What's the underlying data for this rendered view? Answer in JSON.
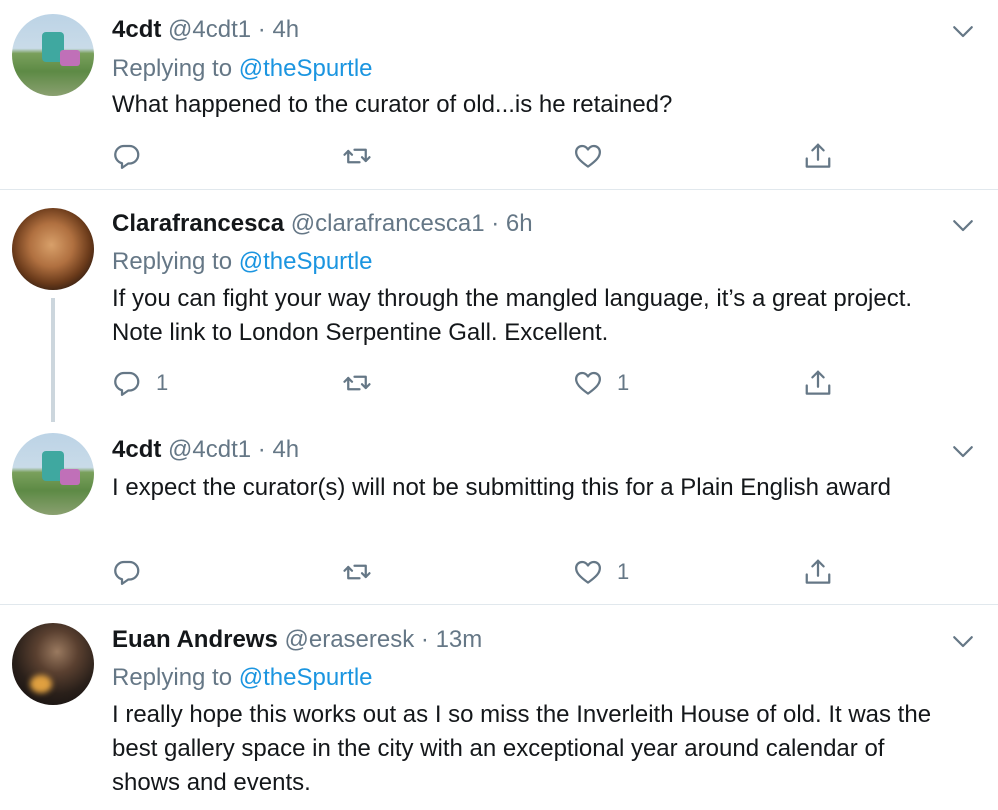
{
  "tweets": [
    {
      "name": "4cdt",
      "handle": "@4cdt1",
      "time": "4h",
      "replying_prefix": "Replying to",
      "replying_to": "@theSpurtle",
      "text": "What happened to the curator of old...is he retained?",
      "reply_count": "",
      "retweet_count": "",
      "like_count": ""
    },
    {
      "name": "Clarafrancesca",
      "handle": "@clarafrancesca1",
      "time": "6h",
      "replying_prefix": "Replying to",
      "replying_to": "@theSpurtle",
      "text": "If you can fight your way through the mangled language, it’s a great project. Note link to London Serpentine Gall. Excellent.",
      "reply_count": "1",
      "retweet_count": "",
      "like_count": "1"
    },
    {
      "name": "4cdt",
      "handle": "@4cdt1",
      "time": "4h",
      "text": "I expect the curator(s) will not be submitting this for a Plain English award",
      "reply_count": "",
      "retweet_count": "",
      "like_count": "1"
    },
    {
      "name": "Euan Andrews",
      "handle": "@eraseresk",
      "time": "13m",
      "replying_prefix": "Replying to",
      "replying_to": "@theSpurtle",
      "text": "I really hope this works out as I so miss the Inverleith House of old. It was the best gallery space in the city with an exceptional year around calendar of shows and events."
    }
  ],
  "separator": "·",
  "icons": {
    "reply": "reply-icon",
    "retweet": "retweet-icon",
    "like": "heart-icon",
    "share": "share-icon",
    "more": "chevron-down-icon"
  },
  "colors": {
    "link": "#1b95e0",
    "muted": "#657786",
    "text": "#14171a",
    "divider": "#e1e8ed"
  }
}
